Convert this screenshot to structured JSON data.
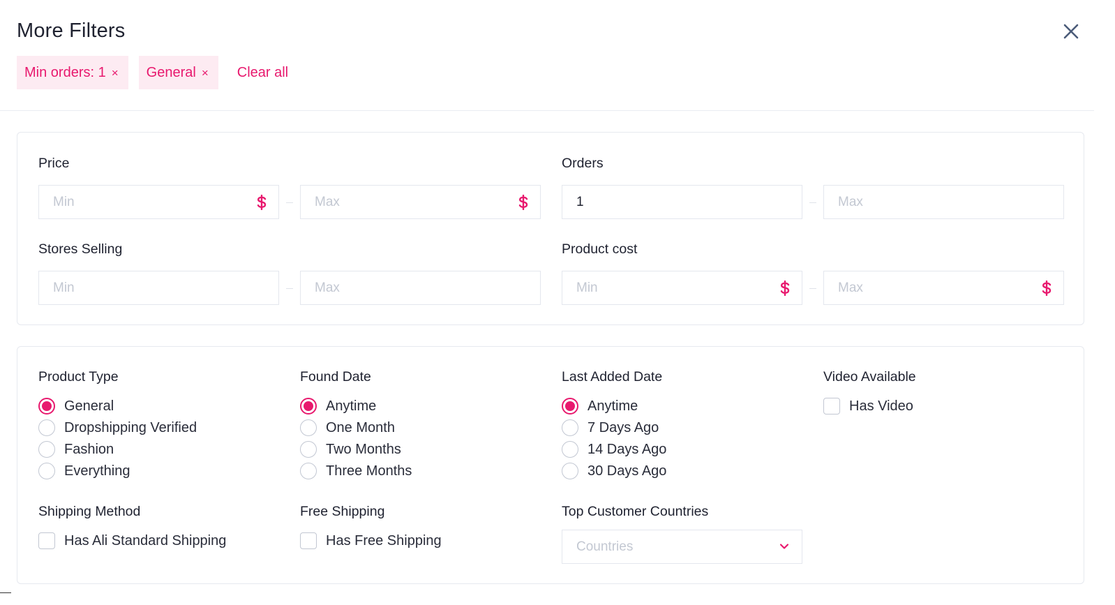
{
  "header": {
    "title": "More Filters",
    "chips": [
      "Min orders: 1",
      "General"
    ],
    "chip_remove_glyph": "×",
    "clear_all": "Clear all"
  },
  "range_filters": {
    "price": {
      "label": "Price",
      "min_placeholder": "Min",
      "max_placeholder": "Max"
    },
    "orders": {
      "label": "Orders",
      "min_value": "1",
      "max_placeholder": "Max"
    },
    "stores_selling": {
      "label": "Stores Selling",
      "min_placeholder": "Min",
      "max_placeholder": "Max"
    },
    "product_cost": {
      "label": "Product cost",
      "min_placeholder": "Min",
      "max_placeholder": "Max"
    }
  },
  "options": {
    "product_type": {
      "label": "Product Type",
      "items": [
        "General",
        "Dropshipping Verified",
        "Fashion",
        "Everything"
      ],
      "selected": "General"
    },
    "found_date": {
      "label": "Found Date",
      "items": [
        "Anytime",
        "One Month",
        "Two Months",
        "Three Months"
      ],
      "selected": "Anytime"
    },
    "last_added_date": {
      "label": "Last Added Date",
      "items": [
        "Anytime",
        "7 Days Ago",
        "14 Days Ago",
        "30 Days Ago"
      ],
      "selected": "Anytime"
    },
    "video_available": {
      "label": "Video Available",
      "checkbox": "Has Video",
      "checked": false
    },
    "shipping_method": {
      "label": "Shipping Method",
      "checkbox": "Has Ali Standard Shipping",
      "checked": false
    },
    "free_shipping": {
      "label": "Free Shipping",
      "checkbox": "Has Free Shipping",
      "checked": false
    },
    "top_customer_countries": {
      "label": "Top Customer Countries",
      "placeholder": "Countries"
    }
  },
  "icons": {
    "close": "close-icon",
    "currency": "dollar-icon",
    "dropdown": "chevron-down-icon"
  },
  "colors": {
    "accent": "#e8196e",
    "chip_bg": "#fdebf2",
    "border": "#e4e7ee",
    "placeholder": "#c3c8d2",
    "close_icon": "#4a5b78"
  }
}
